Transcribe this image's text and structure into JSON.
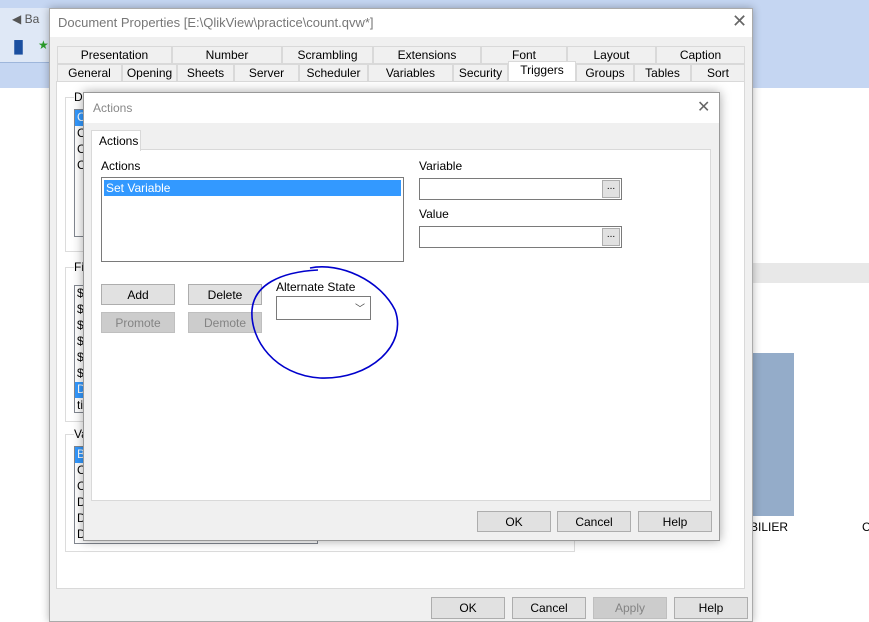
{
  "background": {
    "chart_label": "BILIER",
    "chart_label2": "C",
    "bar_color": "#94acc9",
    "toolbar_text": "Ba"
  },
  "doc_props": {
    "title": "Document Properties [E:\\QlikView\\practice\\count.qvw*]",
    "tabs_row1": [
      "Presentation",
      "Number",
      "Scrambling",
      "Extensions",
      "Font",
      "Layout",
      "Caption"
    ],
    "tabs_row2": [
      "General",
      "Opening",
      "Sheets",
      "Server",
      "Scheduler",
      "Variables",
      "Security",
      "Triggers",
      "Groups",
      "Tables",
      "Sort"
    ],
    "active_tab": "Triggers",
    "group_labels": [
      "Do",
      "Fie",
      "Va"
    ],
    "list1": [
      "C",
      "C",
      "C",
      "C"
    ],
    "list2": [
      "$",
      "$",
      "$",
      "$",
      "$",
      "$",
      "D",
      "tir"
    ],
    "list3": [
      "B",
      "C",
      "C",
      "D",
      "D",
      "D"
    ],
    "ok": "OK",
    "cancel": "Cancel",
    "apply": "Apply",
    "help": "Help"
  },
  "actions_dialog": {
    "title": "Actions",
    "tab": "Actions",
    "actions_label": "Actions",
    "actions_list": [
      "Set Variable"
    ],
    "variable_label": "Variable",
    "variable_value": "",
    "value_label": "Value",
    "value_value": "",
    "browse": "...",
    "add": "Add",
    "delete": "Delete",
    "promote": "Promote",
    "demote": "Demote",
    "alternate_state_label": "Alternate State",
    "alternate_state_value": "",
    "ok": "OK",
    "cancel": "Cancel",
    "help": "Help",
    "annotation_color": "#0000cc"
  }
}
